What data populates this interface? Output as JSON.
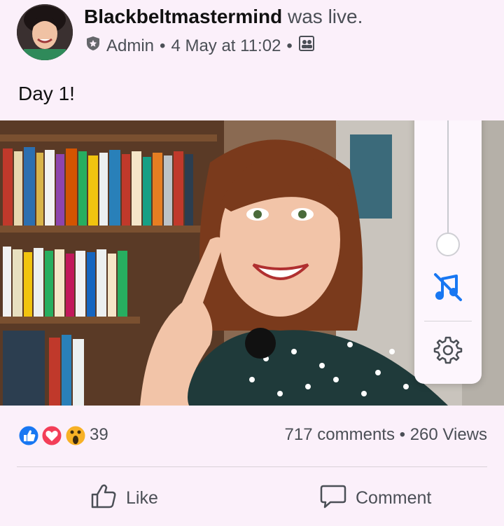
{
  "post": {
    "author": "Blackbeltmastermind",
    "status": "was live.",
    "role": "Admin",
    "separator": "•",
    "timestamp": "4 May at 11:02",
    "audience_icon": "group-audience-icon",
    "text": "Day 1!"
  },
  "video": {
    "side_panel": {
      "volume_level": 0.07,
      "music_icon": "music-off-icon",
      "settings_icon": "gear-icon"
    }
  },
  "stats": {
    "reactions": [
      "like",
      "love",
      "wow"
    ],
    "reaction_count": "39",
    "comments": "717 comments",
    "separator": "•",
    "views": "260 Views"
  },
  "actions": {
    "like_label": "Like",
    "comment_label": "Comment"
  },
  "colors": {
    "background": "#fbf0fa",
    "accent_blue": "#1877f2",
    "love_red": "#f33e58",
    "wow_yellow": "#f7b125"
  }
}
